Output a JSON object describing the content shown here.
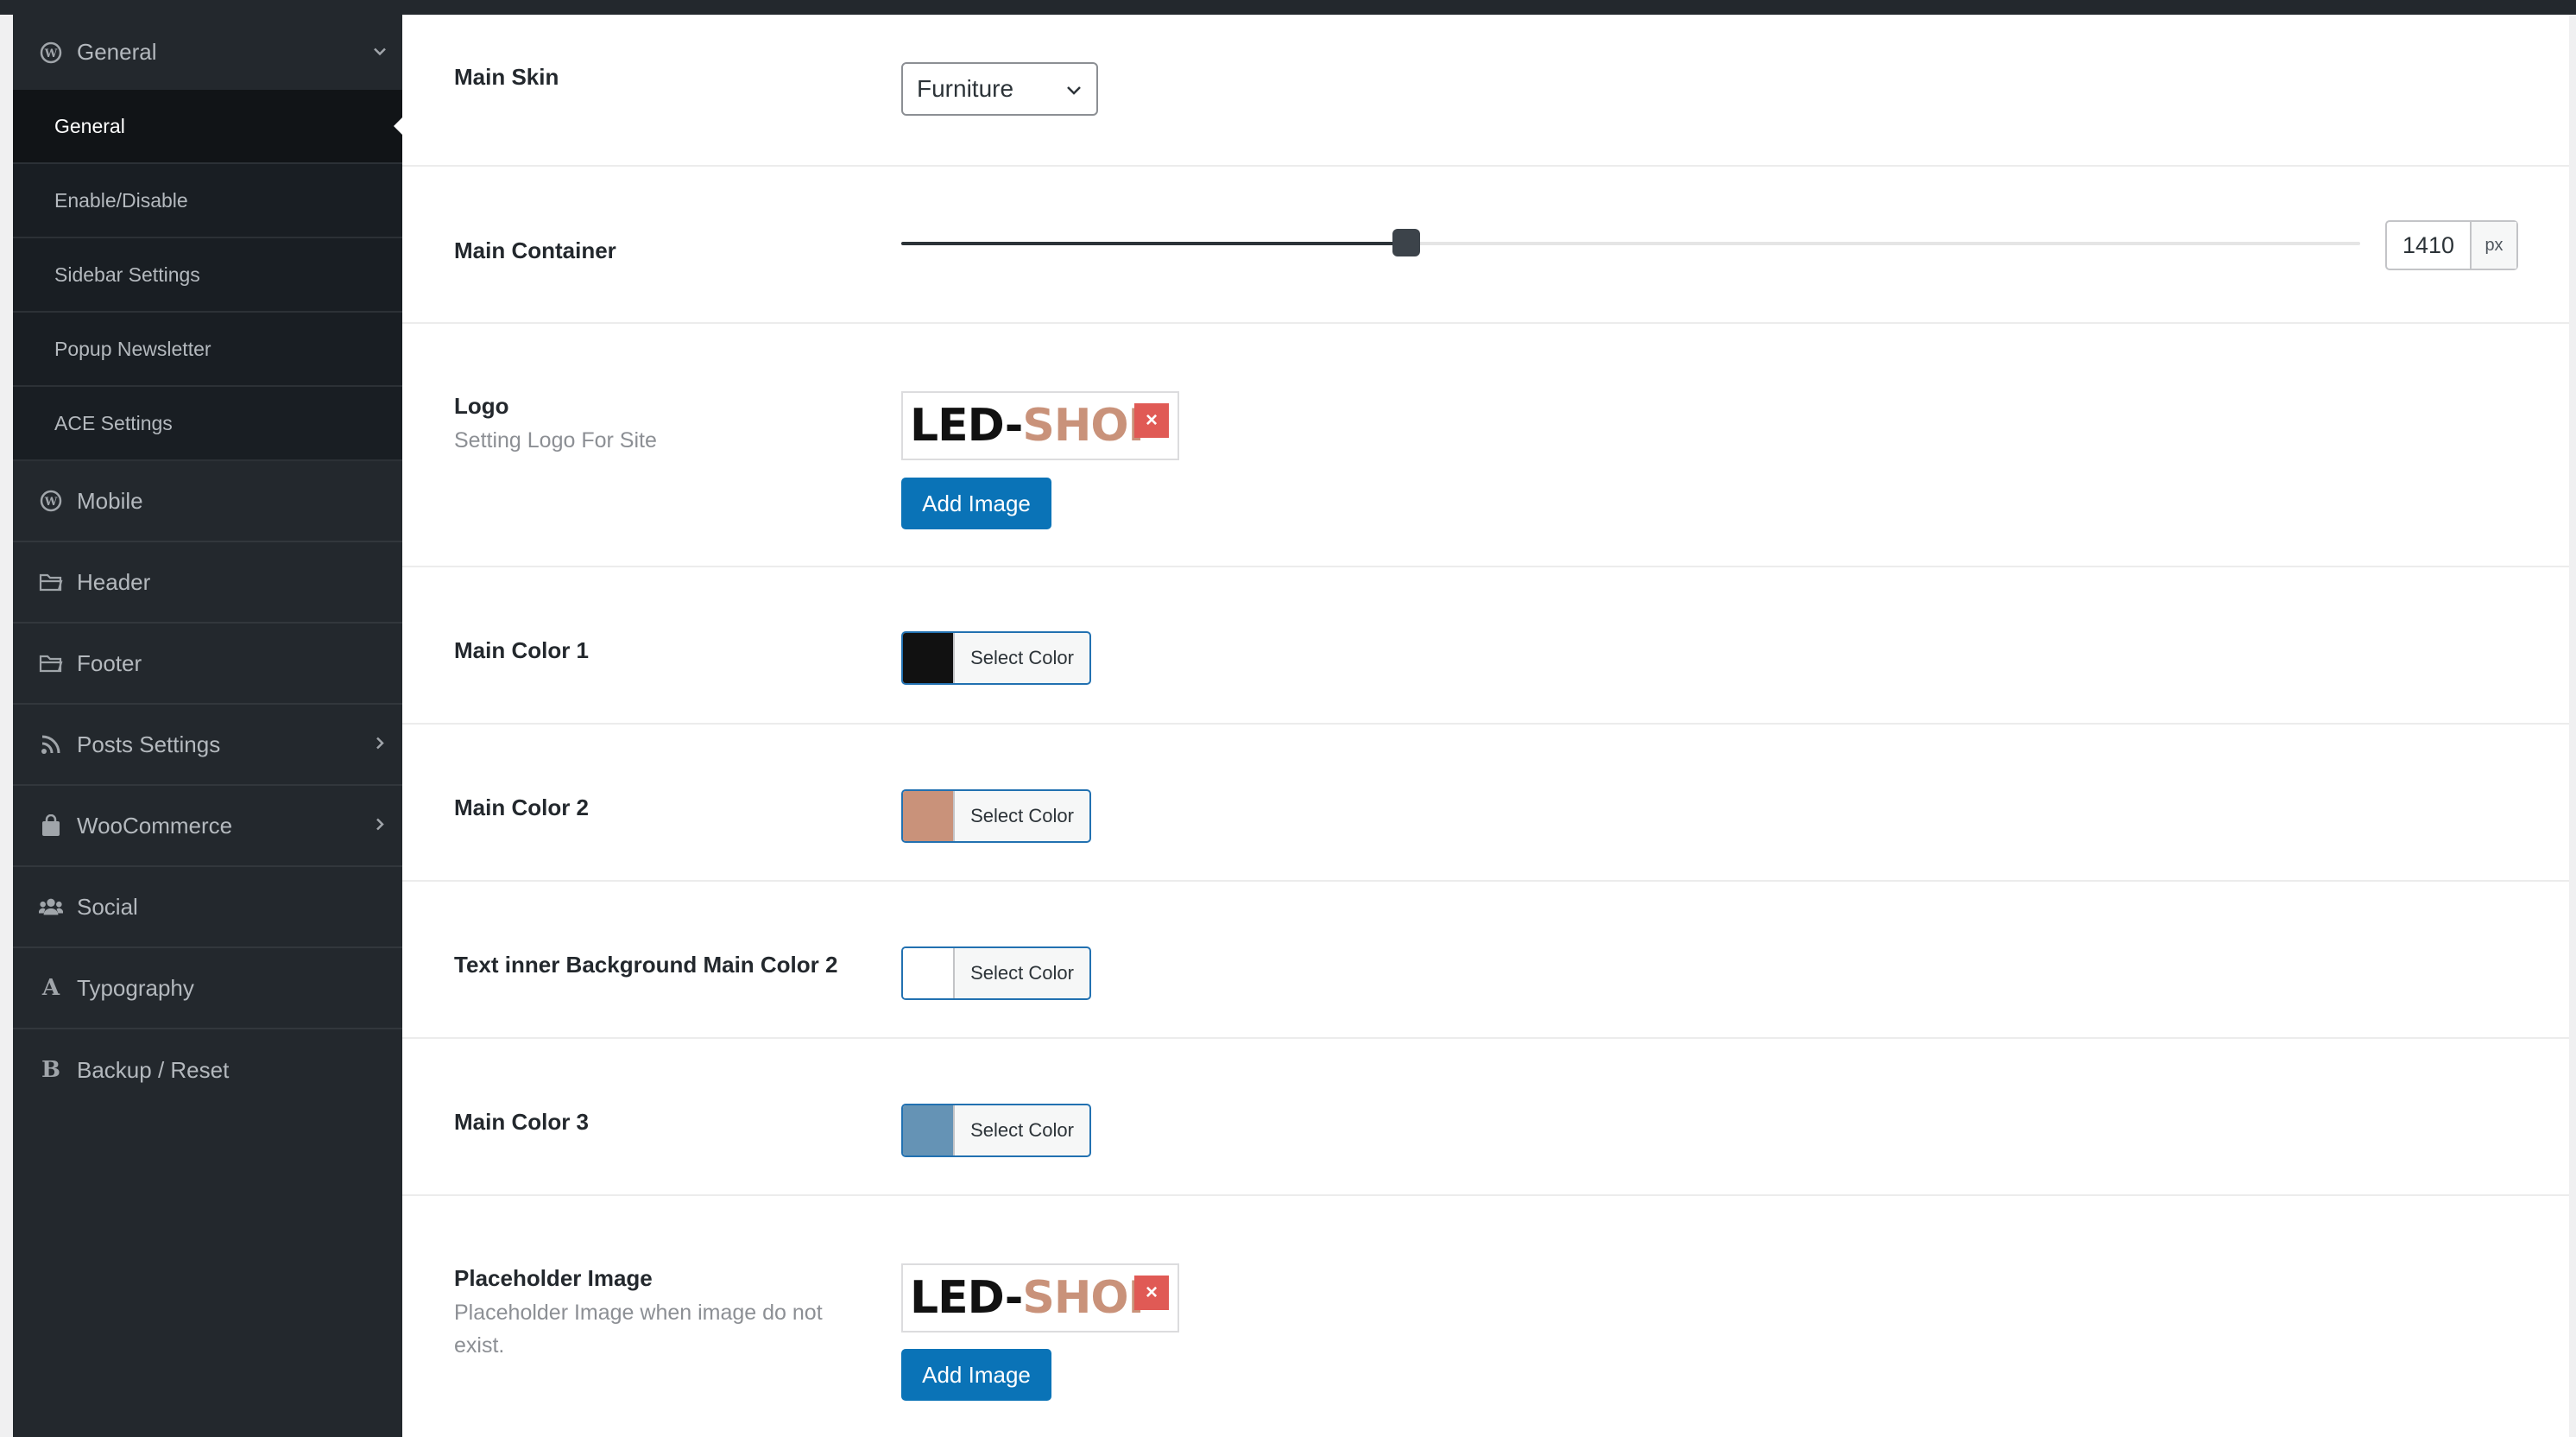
{
  "sidebar": {
    "general": {
      "label": "General",
      "icon": "wordpress-icon"
    },
    "sub_items": [
      "General",
      "Enable/Disable",
      "Sidebar Settings",
      "Popup Newsletter",
      "ACE Settings"
    ],
    "mobile": {
      "label": "Mobile",
      "icon": "wordpress-icon"
    },
    "header": {
      "label": "Header",
      "icon": "folder-icon"
    },
    "footer": {
      "label": "Footer",
      "icon": "folder-icon"
    },
    "posts": {
      "label": "Posts Settings",
      "icon": "rss-icon"
    },
    "woocommerce": {
      "label": "WooCommerce",
      "icon": "bag-icon"
    },
    "social": {
      "label": "Social",
      "icon": "users-icon"
    },
    "typography": {
      "label": "Typography",
      "icon": "typography-icon",
      "glyph": "A"
    },
    "backup": {
      "label": "Backup / Reset",
      "icon": "backup-icon",
      "glyph": "B"
    }
  },
  "main": {
    "skin": {
      "label": "Main Skin",
      "value": "Furniture"
    },
    "container": {
      "label": "Main Container",
      "value": "1410",
      "unit": "px",
      "slider_fraction": 0.346
    },
    "logo": {
      "label": "Logo",
      "desc": "Setting Logo For Site",
      "logo_dark": "LED-",
      "logo_accent": "SHOP",
      "button": "Add Image"
    },
    "color1": {
      "label": "Main Color 1",
      "button": "Select Color",
      "color": "#111111"
    },
    "color2": {
      "label": "Main Color 2",
      "button": "Select Color",
      "color": "#c9927a"
    },
    "text_bg": {
      "label": "Text inner Background Main Color 2",
      "button": "Select Color",
      "color": "#ffffff"
    },
    "color3": {
      "label": "Main Color 3",
      "button": "Select Color",
      "color": "#6593b5"
    },
    "placeholder": {
      "label": "Placeholder Image",
      "desc": "Placeholder Image when image do not exist.",
      "logo_dark": "LED-",
      "logo_accent": "SHOP",
      "button": "Add Image"
    }
  }
}
